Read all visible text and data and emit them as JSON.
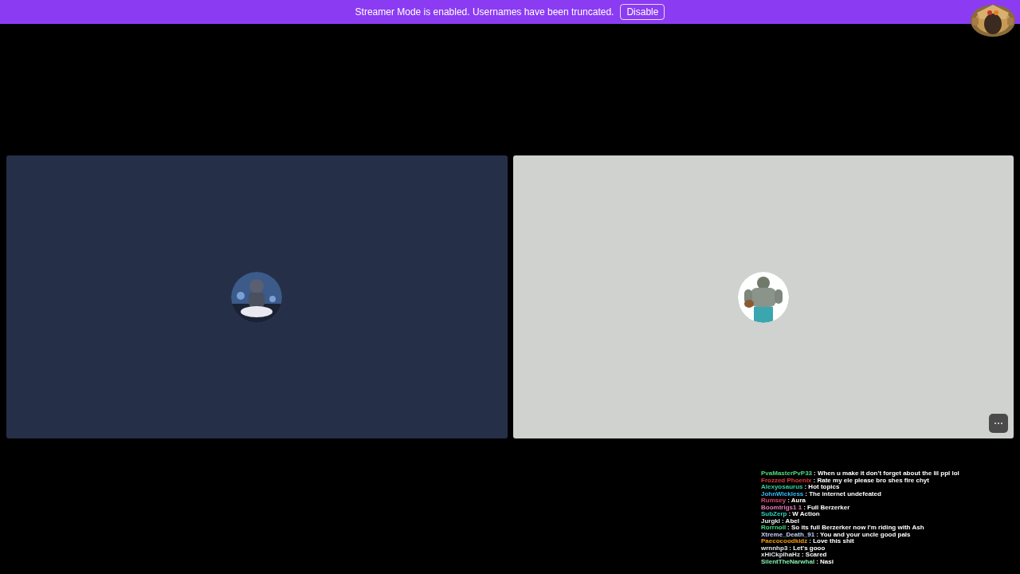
{
  "banner": {
    "message": "Streamer Mode is enabled. Usernames have been truncated.",
    "button": "Disable"
  },
  "tiles": [
    {
      "kind": "dark",
      "color": "#253048"
    },
    {
      "kind": "light",
      "color": "#cfd2ce",
      "more_button": "⋯"
    }
  ],
  "chat": [
    {
      "user": "PvaMasterPvP33",
      "color": "#4ade80",
      "message": ": When u make it don't forget about the lil ppl lol"
    },
    {
      "user": "Frozzed Phoenix",
      "color": "#e03a3a",
      "message": ": Rate my ele please bro shes fire chyt"
    },
    {
      "user": "Alexyosaurus",
      "color": "#34d3a0",
      "message": ": Hot topics"
    },
    {
      "user": "JohnWickless",
      "color": "#38bdf8",
      "message": ": The internet undefeated"
    },
    {
      "user": "Rumsey",
      "color": "#e0457a",
      "message": ": Aura"
    },
    {
      "user": "Boomtrigs1 1",
      "color": "#e879b9",
      "message": ": Full Berzerker"
    },
    {
      "user": "SubZerp",
      "color": "#2dd4bf",
      "message": ": W Action"
    },
    {
      "user": "Jurgkl",
      "color": "#e5e7eb",
      "message": ": Abel"
    },
    {
      "user": "Rorrnoll",
      "color": "#4ade80",
      "message": ": So its full Berzerker now I'm riding with Ash"
    },
    {
      "user": "Xtreme_Death_91",
      "color": "#c7d2fe",
      "message": ": You and your uncle good pals"
    },
    {
      "user": "Paecocoodkidz",
      "color": "#f59e0b",
      "message": ": Love this shit"
    },
    {
      "user": "wrnnhp3",
      "color": "#e5e7eb",
      "message": ": Let's gooo"
    },
    {
      "user": "xHiCkplhaHz",
      "color": "#e5e7eb",
      "message": ": Scared"
    },
    {
      "user": "SilentTheNarwhal",
      "color": "#86efac",
      "message": ": Nasi"
    }
  ]
}
